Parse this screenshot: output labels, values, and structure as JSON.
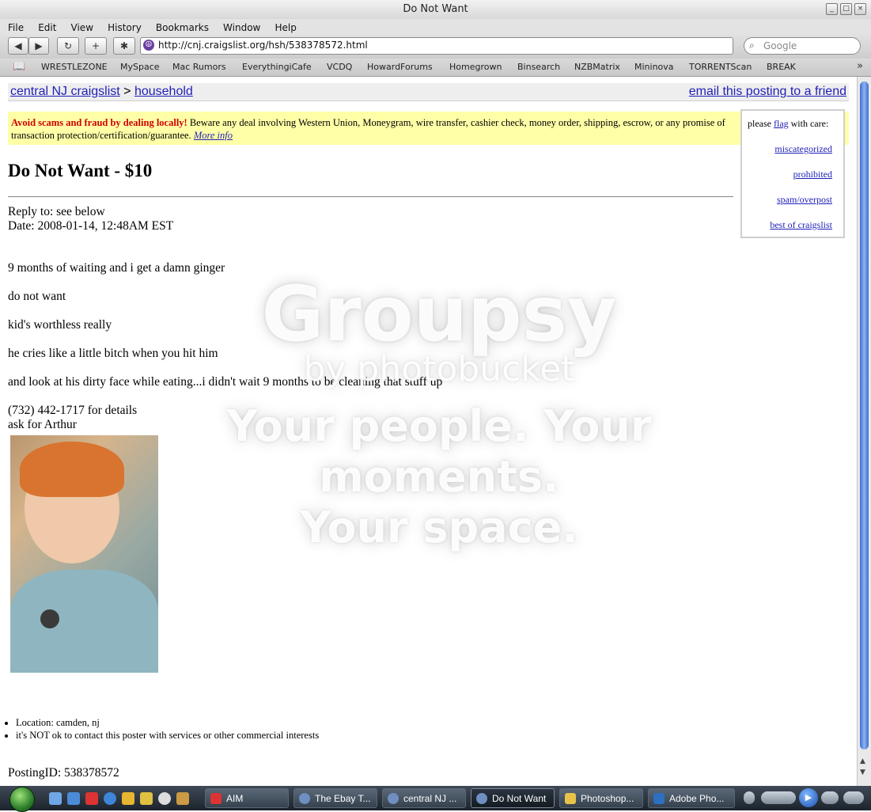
{
  "window": {
    "title": "Do Not Want"
  },
  "menu": [
    "File",
    "Edit",
    "View",
    "History",
    "Bookmarks",
    "Window",
    "Help"
  ],
  "toolbar": {
    "back": "◀",
    "forward": "▶",
    "reload": "↻",
    "add": "+",
    "bug": "✱",
    "url": "http://cnj.craigslist.org/hsh/538378572.html",
    "search_placeholder": "Google"
  },
  "bookmarks": [
    "WRESTLEZONE",
    "MySpace",
    "Mac Rumors",
    "EverythingiCafe",
    "VCDQ",
    "HowardForums",
    "Homegrown",
    "Binsearch",
    "NZBMatrix",
    "Mininova",
    "TORRENTScan",
    "BREAK"
  ],
  "page": {
    "breadcrumb_site": "central NJ craigslist",
    "breadcrumb_sep": ">",
    "breadcrumb_cat": "household",
    "email_friend": "email this posting to a friend",
    "warning_bold": "Avoid scams and fraud by dealing locally!",
    "warning_text": " Beware any deal involving Western Union, Moneygram, wire transfer, cashier check, money order, shipping, escrow, or any promise of transaction protection/certification/guarantee.",
    "warning_link": "More info",
    "flag": {
      "prefix": "please",
      "flag_link": "flag",
      "suffix": "with care:",
      "options": [
        "miscategorized",
        "prohibited",
        "spam/overpost",
        "best of craigslist"
      ]
    },
    "post_title": "Do Not Want - $10",
    "reply_to": "Reply to: see below",
    "date": "Date: 2008-01-14, 12:48AM EST",
    "body": [
      "9 months of waiting and i get a damn ginger",
      "do not want",
      "kid's worthless really",
      "he cries like a little bitch when you hit him",
      "and look at his dirty face while eating...i didn't wait 9 months to be cleaning that stuff up",
      "(732) 442-1717 for details",
      "ask for Arthur"
    ],
    "bullets": [
      "Location: camden, nj",
      "it's NOT ok to contact this poster with services or other commercial interests"
    ],
    "posting_id": "PostingID: 538378572"
  },
  "watermark": {
    "brand": "Groupsy",
    "by": "by photobucket",
    "tagline1": "Your people. Your moments.",
    "tagline2": "Your space."
  },
  "taskbar": {
    "tasks": [
      "AIM",
      "The Ebay T...",
      "central NJ ...",
      "Do Not Want",
      "Photoshop...",
      "Adobe Pho..."
    ],
    "active_index": 3
  },
  "colors": {
    "link": "#1f1fb8",
    "warning_bg": "#ffffa8",
    "warning_red": "#d10000"
  }
}
